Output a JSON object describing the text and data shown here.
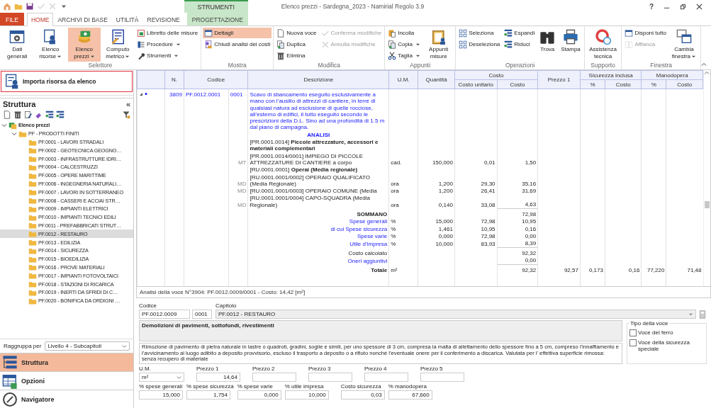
{
  "window": {
    "title": "Elenco prezzi - Sardegna_2023 - Namirial Regolo 3.9",
    "help": "?"
  },
  "quick_access": [
    {
      "disabled": false
    },
    {
      "disabled": false
    },
    {
      "disabled": false
    },
    {
      "disabled": true
    },
    {
      "disabled": true
    },
    {
      "disabled": false
    }
  ],
  "tabs": [
    {
      "label": "FILE",
      "kind": "file",
      "selected": false
    },
    {
      "label": "HOME",
      "kind": "normal",
      "selected": true
    },
    {
      "label": "ARCHIVI DI BASE",
      "kind": "normal",
      "selected": false
    },
    {
      "label": "UTILITÀ",
      "kind": "normal",
      "selected": false
    },
    {
      "label": "REVISIONE",
      "kind": "normal",
      "selected": false
    },
    {
      "label": "PROGETTAZIONE",
      "kind": "contextual",
      "context_label": "STRUMENTI",
      "selected": false
    }
  ],
  "ribbon": {
    "groups": [
      {
        "label": "Selettore",
        "columns": [
          {
            "items": [
              {
                "label": "Dati generali",
                "kind": "large",
                "selected": false,
                "dropdown": false,
                "disabled": false
              }
            ]
          },
          {
            "items": [
              {
                "label": "Elenco risorse",
                "kind": "large",
                "selected": false,
                "dropdown": true,
                "disabled": false
              }
            ]
          },
          {
            "items": [
              {
                "label": "Elenco prezzi",
                "kind": "large",
                "selected": true,
                "dropdown": true,
                "disabled": false
              }
            ]
          },
          {
            "items": [
              {
                "label": "Computo metrico",
                "kind": "large",
                "selected": false,
                "dropdown": true,
                "disabled": false
              }
            ]
          },
          {
            "items": [
              {
                "label": "Libretto delle misure",
                "kind": "small",
                "selected": false,
                "dropdown": false,
                "disabled": false
              },
              {
                "label": "Procedure",
                "kind": "small",
                "selected": false,
                "dropdown": true,
                "disabled": false
              },
              {
                "label": "Strumenti",
                "kind": "small",
                "selected": false,
                "dropdown": true,
                "disabled": false
              }
            ]
          }
        ]
      },
      {
        "label": "Mostra",
        "columns": [
          {
            "items": [
              {
                "label": "Dettagli",
                "kind": "small",
                "selected": true,
                "dropdown": false,
                "disabled": false
              },
              {
                "label": "Chiudi analisi dei costi",
                "kind": "small",
                "selected": false,
                "dropdown": false,
                "disabled": false
              }
            ]
          }
        ]
      },
      {
        "label": "Modifica",
        "columns": [
          {
            "items": [
              {
                "label": "Nuova voce",
                "kind": "small",
                "selected": false,
                "dropdown": false,
                "disabled": false
              },
              {
                "label": "Duplica",
                "kind": "small",
                "selected": false,
                "dropdown": false,
                "disabled": false
              },
              {
                "label": "Elimina",
                "kind": "small",
                "selected": false,
                "dropdown": false,
                "disabled": false
              }
            ]
          },
          {
            "items": [
              {
                "label": "Conferma modifiche",
                "kind": "small",
                "selected": false,
                "dropdown": false,
                "disabled": true
              },
              {
                "label": "Annulla modifiche",
                "kind": "small",
                "selected": false,
                "dropdown": false,
                "disabled": true
              }
            ]
          }
        ]
      },
      {
        "label": "Appunti",
        "columns": [
          {
            "items": [
              {
                "label": "Incolla",
                "kind": "small",
                "selected": false,
                "dropdown": false,
                "disabled": false
              },
              {
                "label": "Copia",
                "kind": "small",
                "selected": false,
                "dropdown": true,
                "disabled": false
              },
              {
                "label": "Taglia",
                "kind": "small",
                "selected": false,
                "dropdown": true,
                "disabled": false
              }
            ]
          },
          {
            "items": [
              {
                "label": "Appunti misure",
                "kind": "large",
                "selected": false,
                "dropdown": false,
                "disabled": false
              }
            ]
          }
        ]
      },
      {
        "label": "Operazioni",
        "columns": [
          {
            "items": [
              {
                "label": "Seleziona",
                "kind": "small",
                "selected": false,
                "dropdown": false,
                "disabled": false
              },
              {
                "label": "Deseleziona",
                "kind": "small",
                "selected": false,
                "dropdown": false,
                "disabled": false
              }
            ]
          },
          {
            "items": [
              {
                "label": "Espandi",
                "kind": "small",
                "selected": false,
                "dropdown": false,
                "disabled": false
              },
              {
                "label": "Riduci",
                "kind": "small",
                "selected": false,
                "dropdown": false,
                "disabled": false
              }
            ]
          },
          {
            "items": [
              {
                "label": "Trova",
                "kind": "large",
                "selected": false,
                "dropdown": false,
                "disabled": false
              }
            ]
          },
          {
            "items": [
              {
                "label": "Stampa",
                "kind": "large",
                "selected": false,
                "dropdown": false,
                "disabled": false
              }
            ]
          }
        ]
      },
      {
        "label": "Supporto",
        "columns": [
          {
            "items": [
              {
                "label": "Assistenza tecnica",
                "kind": "large",
                "selected": false,
                "dropdown": false,
                "disabled": false
              }
            ]
          }
        ]
      },
      {
        "label": "Finestra",
        "columns": [
          {
            "items": [
              {
                "label": "Disponi tutto",
                "kind": "small",
                "selected": false,
                "dropdown": false,
                "disabled": false
              },
              {
                "label": "Affianca",
                "kind": "small",
                "selected": false,
                "dropdown": false,
                "disabled": true
              }
            ]
          },
          {
            "items": [
              {
                "label": "Cambia finestra",
                "kind": "large",
                "selected": false,
                "dropdown": true,
                "disabled": false
              }
            ]
          }
        ]
      }
    ]
  },
  "sidebar": {
    "import_button": "Importa risorsa da elenco",
    "title": "Struttura",
    "collapse": "«",
    "tree": [
      {
        "label": "Elenco prezzi",
        "selected": false,
        "expanded": true,
        "children": [
          {
            "label": "PF - PRODOTTI FINITI",
            "selected": false,
            "expanded": true,
            "children": [
              {
                "label": "PF.0001 - LAVORI STRADALI",
                "selected": false
              },
              {
                "label": "PF.0002 - GEOTECNICA GEOGNO…",
                "selected": false
              },
              {
                "label": "PF.0003 - INFRASTRUTTURE IDRI…",
                "selected": false
              },
              {
                "label": "PF.0004 - CALCESTRUZZI",
                "selected": false
              },
              {
                "label": "PF.0005 - OPERE MARITTIME",
                "selected": false
              },
              {
                "label": "PF.0006 - INGEGNERIA NATURALI…",
                "selected": false
              },
              {
                "label": "PF.0007 - LAVORI IN SOTTERRANEO",
                "selected": false
              },
              {
                "label": "PF.0008 - CASSERI E ACCIAI STR…",
                "selected": false
              },
              {
                "label": "PF.0009 - IMPIANTI ELETTRICI",
                "selected": false
              },
              {
                "label": "PF.0010 - IMPIANTI TECNICI EDILI",
                "selected": false
              },
              {
                "label": "PF.0011 - PREFABBRICATI STRUT…",
                "selected": false
              },
              {
                "label": "PF.0012 - RESTAURO",
                "selected": true
              },
              {
                "label": "PF.0013 - EDILIZIA",
                "selected": false
              },
              {
                "label": "PF.0014 - SICUREZZA",
                "selected": false
              },
              {
                "label": "PF.0015 - BIOEDILIZIA",
                "selected": false
              },
              {
                "label": "PF.0016 - PROVE MATERIALI",
                "selected": false
              },
              {
                "label": "PF.0017 - IMPIANTI FOTOVOLTAICI",
                "selected": false
              },
              {
                "label": "PF.0018 - STAZIONI DI RICARICA",
                "selected": false
              },
              {
                "label": "PF.0019 - INERTI DA SFRIDI DI C…",
                "selected": false
              },
              {
                "label": "PF.0020 - BONIFICA DA ORDIGNI …",
                "selected": false
              }
            ]
          }
        ]
      }
    ],
    "group_by_label": "Raggruppa per",
    "group_by_value": "Livello 4 - Subcapitoli",
    "nav": [
      {
        "label": "Struttura",
        "selected": true
      },
      {
        "label": "Opzioni",
        "selected": false
      },
      {
        "label": "Navigatore",
        "selected": false
      }
    ]
  },
  "table": {
    "columns": [
      {
        "label": "N."
      },
      {
        "label": "Codice"
      },
      {
        "label": "Descrizione"
      },
      {
        "label": "U.M."
      },
      {
        "label": "Quantità"
      },
      {
        "label": "Costo",
        "sub": [
          "Costo unitario",
          "Costo"
        ]
      },
      {
        "label": "Prezzo 1"
      },
      {
        "label": "Sicurezza inclusa",
        "sub": [
          "%",
          "Costo"
        ]
      },
      {
        "label": "Manodopera",
        "sub": [
          "%",
          "Costo"
        ]
      }
    ],
    "rows": [
      {
        "kind": "item",
        "expanded": true,
        "n": "3809",
        "code": "PF.0012.0001",
        "sub": "0001",
        "desc": "Scavo di sbancamento eseguito esclusivamente a mano con l’ausilio di attrezzi di cantiere, in terre di qualsiasi natura ad esclusione di quelle rocciose, all’esterno di edifici, il tutto eseguito secondo le prescrizioni della D.L. Sino ad una profondità di 1.5 m dal piano di campagna."
      },
      {
        "kind": "heading",
        "desc": "ANALISI"
      },
      {
        "kind": "group",
        "desc": "[PR.0001.0014] **Piccole attrezzature, accessori e materiali complementari**"
      },
      {
        "kind": "resource",
        "tag": "MT",
        "desc": "[PR.0001.0014/0001] IMPIEGO DI PICCOLE ATTREZZATURE DI CANTIERE a corpo",
        "um": "cad.",
        "qty": "150,000",
        "unit": "0,01",
        "cost": "1,50"
      },
      {
        "kind": "group",
        "desc": "[RU.0001.0001] **Operai (Media regionale)**"
      },
      {
        "kind": "resource",
        "tag": "MD",
        "desc": "[RU.0001.0001/0002] OPERAIO QUALIFICATO (Media Regionale)",
        "um": "ora",
        "qty": "1,200",
        "unit": "29,30",
        "cost": "35,16"
      },
      {
        "kind": "resource",
        "tag": "MD",
        "desc": "[RU.0001.0001/0003] OPERAIO COMUNE (Media",
        "um": "ora",
        "qty": "1,200",
        "unit": "26,41",
        "cost": "31,69"
      },
      {
        "kind": "resource",
        "tag": "MD",
        "desc": "[RU.0001.0001/0004] CAPO-SQUADRA (Media Regionale)",
        "um": "ora",
        "qty": "0,140",
        "unit": "33,08",
        "cost": "4,63"
      },
      {
        "kind": "total",
        "desc": "SOMMANO",
        "cost": "72,98"
      },
      {
        "kind": "charge",
        "desc": "Spese generali",
        "um": "%",
        "qty": "15,000",
        "unit": "72,98",
        "cost": "10,95"
      },
      {
        "kind": "charge",
        "desc": "di cui Spese sicurezza",
        "um": "%",
        "qty": "1,461",
        "unit": "10,95",
        "cost": "0,16"
      },
      {
        "kind": "charge",
        "desc": "Spese varie",
        "um": "%",
        "qty": "0,000",
        "unit": "72,98",
        "cost": "0,00"
      },
      {
        "kind": "charge",
        "desc": "Utile d’impresa",
        "um": "%",
        "qty": "10,000",
        "unit": "83,93",
        "cost": "8,39"
      },
      {
        "kind": "subtotal",
        "desc": "Costo calcolato",
        "cost": "92,32"
      },
      {
        "kind": "charge",
        "desc": "Oneri aggiuntivi",
        "cost": "0,00"
      },
      {
        "kind": "final",
        "desc": "Totale",
        "um": "m²",
        "cost": "92,32",
        "price": "92,57",
        "sic_pct": "0,173",
        "sic_cost": "0,16",
        "man_pct": "77,220",
        "man_cost": "71,48"
      }
    ]
  },
  "status_text": "Analisi della voce N°3904: PF.0012.0009/0001 - Costo: 14,42 [m²]",
  "details": {
    "code_label": "Codice",
    "code": "PF.0012.0009",
    "code_suffix": "0001",
    "chapter_label": "Capitolo",
    "chapter": "PF.0012 - RESTAURO",
    "title": "Demolizioni di pavimenti, sottofondi, rivestimenti",
    "description": "Rimozione di pavimento di pietra naturale in lastre o quadroti, gradini, soglie e simili, per uno spessore di 3 cm, compresa la malta di allettamento dello spessore fino a 5 cm, compreso l’innaffiamento e l’avvicinamento al luogo adibito a deposito provvisorio, escluso il trasporto a deposito o a rifiuto nonché l’eventuale onere per il conferimento a discarica. Valutata per l’ effettiva superficie rimossa: senza recupero di materiale",
    "voice_type": {
      "label": "Tipo della voce",
      "options": [
        {
          "label": "Voce del ferro",
          "checked": false
        },
        {
          "label": "Voce della sicurezza speciale",
          "checked": false
        }
      ]
    },
    "um": {
      "label": "U.M.",
      "value": "m²"
    },
    "prices": [
      {
        "label": "Prezzo 1",
        "value": "14,64"
      },
      {
        "label": "Prezzo 2"
      },
      {
        "label": "Prezzo 3"
      },
      {
        "label": "Prezzo 4"
      },
      {
        "label": "Prezzo 5"
      }
    ],
    "percentages": [
      {
        "label": "% spese generali",
        "value": "15,000"
      },
      {
        "label": "% spese sicurezza",
        "value": "1,754"
      },
      {
        "label": "% spese varie",
        "value": "0,000"
      },
      {
        "label": "% utile impresa",
        "value": "10,000"
      },
      {
        "label": "Costo sicurezza",
        "value": "0,03"
      },
      {
        "label": "% manodopera",
        "value": "67,660"
      }
    ]
  }
}
